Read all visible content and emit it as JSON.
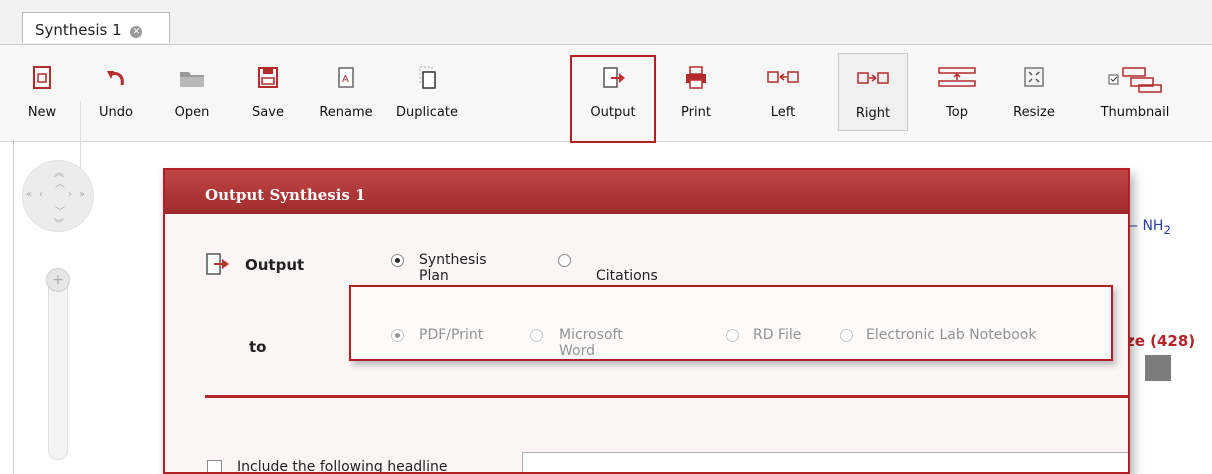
{
  "tab": {
    "title": "Synthesis 1"
  },
  "toolbar": {
    "new": "New",
    "undo": "Undo",
    "open": "Open",
    "save": "Save",
    "rename": "Rename",
    "duplicate": "Duplicate",
    "output": "Output",
    "print": "Print",
    "left": "Left",
    "right": "Right",
    "top": "Top",
    "resize": "Resize",
    "thumbnail": "Thumbnail"
  },
  "background": {
    "structure_text": "NH",
    "structure_sub": "2",
    "size_text": "ze (428)"
  },
  "dialog": {
    "title": "Output Synthesis 1",
    "output_label": "Output",
    "to_label": "to",
    "output_options": [
      {
        "label": "Synthesis Plan",
        "selected": true
      },
      {
        "label": "Citations",
        "selected": false
      }
    ],
    "to_options": [
      {
        "label": "PDF/Print",
        "selected": true
      },
      {
        "label": "Microsoft Word",
        "selected": false
      },
      {
        "label": "RD File",
        "selected": false
      },
      {
        "label": "Electronic Lab Notebook",
        "selected": false
      }
    ],
    "headline_label": "Include the following headline",
    "headline_value": ""
  },
  "colors": {
    "accent": "#b21f24",
    "header": "#a83434",
    "link_blue": "#2b3ca5"
  }
}
